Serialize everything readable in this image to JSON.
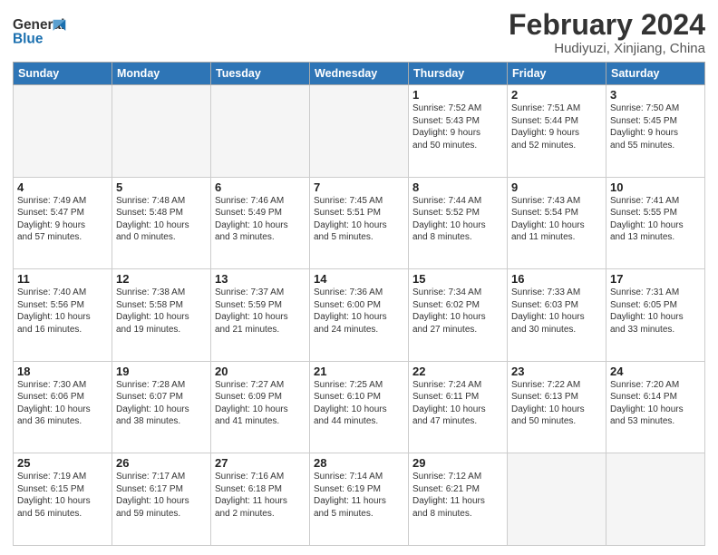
{
  "header": {
    "logo_line1": "General",
    "logo_line2": "Blue",
    "main_title": "February 2024",
    "subtitle": "Hudiyuzi, Xinjiang, China"
  },
  "weekdays": [
    "Sunday",
    "Monday",
    "Tuesday",
    "Wednesday",
    "Thursday",
    "Friday",
    "Saturday"
  ],
  "weeks": [
    [
      {
        "day": "",
        "info": ""
      },
      {
        "day": "",
        "info": ""
      },
      {
        "day": "",
        "info": ""
      },
      {
        "day": "",
        "info": ""
      },
      {
        "day": "1",
        "info": "Sunrise: 7:52 AM\nSunset: 5:43 PM\nDaylight: 9 hours\nand 50 minutes."
      },
      {
        "day": "2",
        "info": "Sunrise: 7:51 AM\nSunset: 5:44 PM\nDaylight: 9 hours\nand 52 minutes."
      },
      {
        "day": "3",
        "info": "Sunrise: 7:50 AM\nSunset: 5:45 PM\nDaylight: 9 hours\nand 55 minutes."
      }
    ],
    [
      {
        "day": "4",
        "info": "Sunrise: 7:49 AM\nSunset: 5:47 PM\nDaylight: 9 hours\nand 57 minutes."
      },
      {
        "day": "5",
        "info": "Sunrise: 7:48 AM\nSunset: 5:48 PM\nDaylight: 10 hours\nand 0 minutes."
      },
      {
        "day": "6",
        "info": "Sunrise: 7:46 AM\nSunset: 5:49 PM\nDaylight: 10 hours\nand 3 minutes."
      },
      {
        "day": "7",
        "info": "Sunrise: 7:45 AM\nSunset: 5:51 PM\nDaylight: 10 hours\nand 5 minutes."
      },
      {
        "day": "8",
        "info": "Sunrise: 7:44 AM\nSunset: 5:52 PM\nDaylight: 10 hours\nand 8 minutes."
      },
      {
        "day": "9",
        "info": "Sunrise: 7:43 AM\nSunset: 5:54 PM\nDaylight: 10 hours\nand 11 minutes."
      },
      {
        "day": "10",
        "info": "Sunrise: 7:41 AM\nSunset: 5:55 PM\nDaylight: 10 hours\nand 13 minutes."
      }
    ],
    [
      {
        "day": "11",
        "info": "Sunrise: 7:40 AM\nSunset: 5:56 PM\nDaylight: 10 hours\nand 16 minutes."
      },
      {
        "day": "12",
        "info": "Sunrise: 7:38 AM\nSunset: 5:58 PM\nDaylight: 10 hours\nand 19 minutes."
      },
      {
        "day": "13",
        "info": "Sunrise: 7:37 AM\nSunset: 5:59 PM\nDaylight: 10 hours\nand 21 minutes."
      },
      {
        "day": "14",
        "info": "Sunrise: 7:36 AM\nSunset: 6:00 PM\nDaylight: 10 hours\nand 24 minutes."
      },
      {
        "day": "15",
        "info": "Sunrise: 7:34 AM\nSunset: 6:02 PM\nDaylight: 10 hours\nand 27 minutes."
      },
      {
        "day": "16",
        "info": "Sunrise: 7:33 AM\nSunset: 6:03 PM\nDaylight: 10 hours\nand 30 minutes."
      },
      {
        "day": "17",
        "info": "Sunrise: 7:31 AM\nSunset: 6:05 PM\nDaylight: 10 hours\nand 33 minutes."
      }
    ],
    [
      {
        "day": "18",
        "info": "Sunrise: 7:30 AM\nSunset: 6:06 PM\nDaylight: 10 hours\nand 36 minutes."
      },
      {
        "day": "19",
        "info": "Sunrise: 7:28 AM\nSunset: 6:07 PM\nDaylight: 10 hours\nand 38 minutes."
      },
      {
        "day": "20",
        "info": "Sunrise: 7:27 AM\nSunset: 6:09 PM\nDaylight: 10 hours\nand 41 minutes."
      },
      {
        "day": "21",
        "info": "Sunrise: 7:25 AM\nSunset: 6:10 PM\nDaylight: 10 hours\nand 44 minutes."
      },
      {
        "day": "22",
        "info": "Sunrise: 7:24 AM\nSunset: 6:11 PM\nDaylight: 10 hours\nand 47 minutes."
      },
      {
        "day": "23",
        "info": "Sunrise: 7:22 AM\nSunset: 6:13 PM\nDaylight: 10 hours\nand 50 minutes."
      },
      {
        "day": "24",
        "info": "Sunrise: 7:20 AM\nSunset: 6:14 PM\nDaylight: 10 hours\nand 53 minutes."
      }
    ],
    [
      {
        "day": "25",
        "info": "Sunrise: 7:19 AM\nSunset: 6:15 PM\nDaylight: 10 hours\nand 56 minutes."
      },
      {
        "day": "26",
        "info": "Sunrise: 7:17 AM\nSunset: 6:17 PM\nDaylight: 10 hours\nand 59 minutes."
      },
      {
        "day": "27",
        "info": "Sunrise: 7:16 AM\nSunset: 6:18 PM\nDaylight: 11 hours\nand 2 minutes."
      },
      {
        "day": "28",
        "info": "Sunrise: 7:14 AM\nSunset: 6:19 PM\nDaylight: 11 hours\nand 5 minutes."
      },
      {
        "day": "29",
        "info": "Sunrise: 7:12 AM\nSunset: 6:21 PM\nDaylight: 11 hours\nand 8 minutes."
      },
      {
        "day": "",
        "info": ""
      },
      {
        "day": "",
        "info": ""
      }
    ]
  ]
}
